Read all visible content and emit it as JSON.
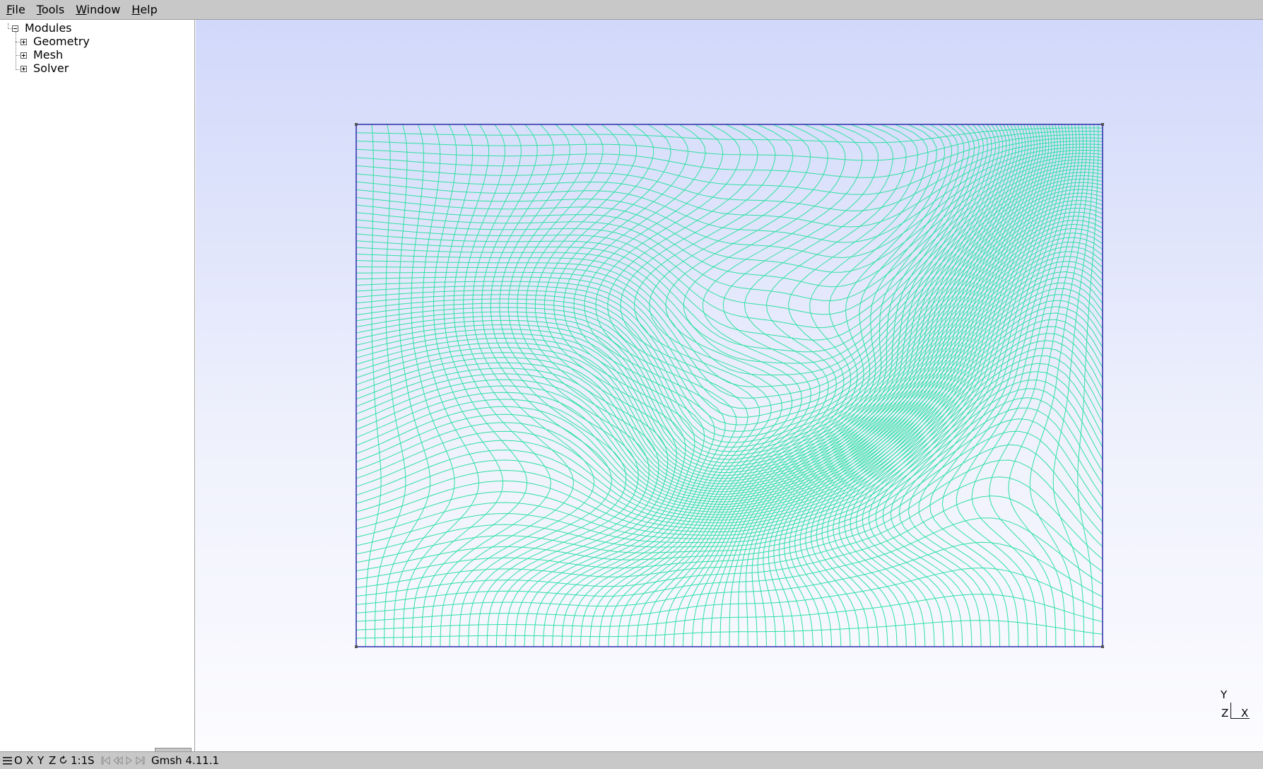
{
  "menubar": {
    "file": {
      "mnemonic": "F",
      "rest": "ile"
    },
    "tools": {
      "mnemonic": "T",
      "rest": "ools"
    },
    "window": {
      "mnemonic": "W",
      "rest": "indow"
    },
    "help": {
      "mnemonic": "H",
      "rest": "elp"
    }
  },
  "tree": {
    "root": "Modules",
    "items": [
      "Geometry",
      "Mesh",
      "Solver"
    ]
  },
  "axes": {
    "y": "Y",
    "z": "Z",
    "x": "X"
  },
  "statusbar": {
    "menu_icon": "hamburger-icon",
    "o": "O",
    "x": "X",
    "y": "Y",
    "z": "Z",
    "rotate_icon": "rotate-icon",
    "scale": "1:1",
    "s": "S",
    "version": "Gmsh 4.11.1"
  },
  "colors": {
    "mesh_lines": "#2fe0a4",
    "boundary": "#2a2aa8",
    "background_top": "#d1d8fa",
    "background_bottom": "#fcfcff"
  }
}
